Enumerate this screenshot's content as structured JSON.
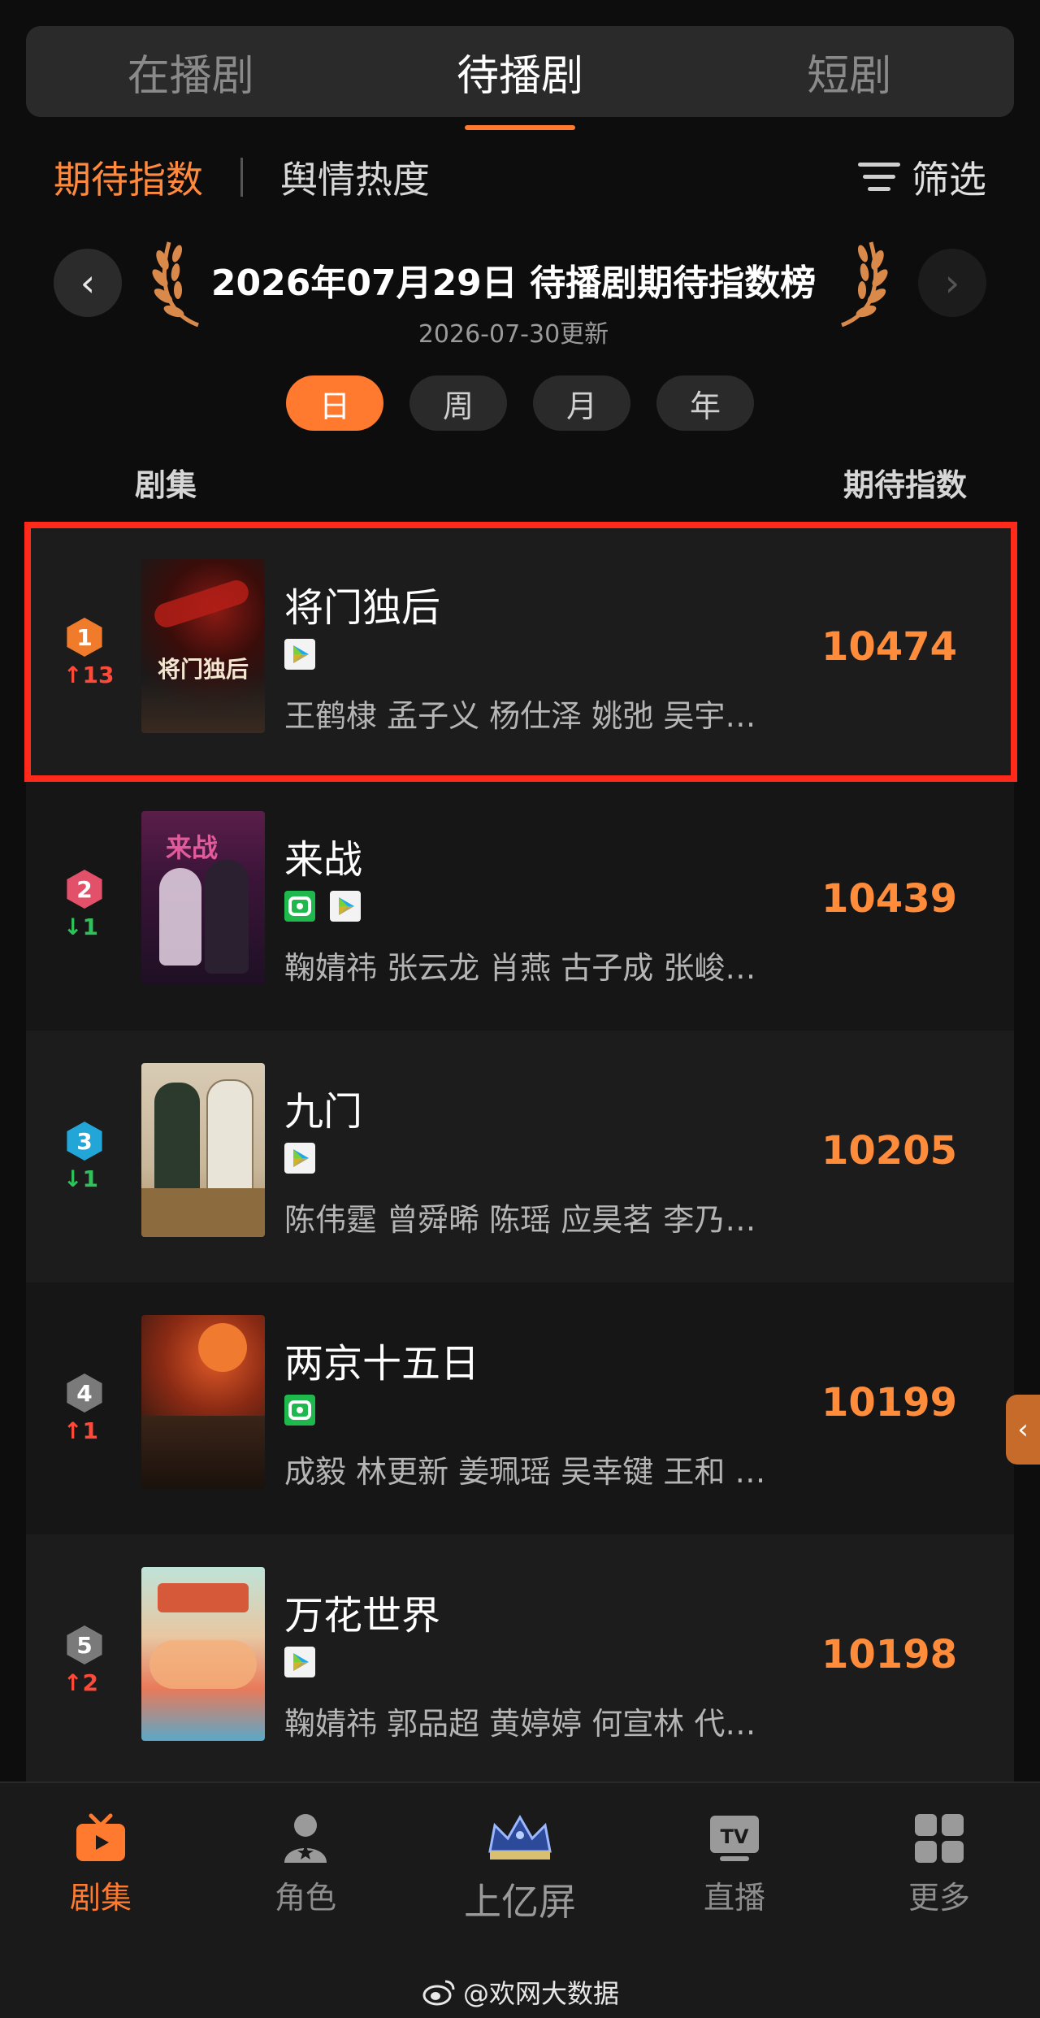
{
  "top_tabs": [
    {
      "label": "在播剧",
      "active": false
    },
    {
      "label": "待播剧",
      "active": true
    },
    {
      "label": "短剧",
      "active": false
    }
  ],
  "subtabs": [
    {
      "label": "期待指数",
      "active": true
    },
    {
      "label": "舆情热度",
      "active": false
    }
  ],
  "filter": {
    "label": "筛选",
    "icon": "filter-icon"
  },
  "board": {
    "title": "2026年07月29日 待播剧期待指数榜",
    "updated": "2026-07-30更新",
    "prev_icon": "chevron-left-icon",
    "next_icon": "chevron-right-icon"
  },
  "periods": [
    {
      "label": "日",
      "active": true
    },
    {
      "label": "周",
      "active": false
    },
    {
      "label": "月",
      "active": false
    },
    {
      "label": "年",
      "active": false
    }
  ],
  "columns": {
    "left": "剧集",
    "right": "期待指数"
  },
  "shows": [
    {
      "rank": "1",
      "rank_color": "#f07b2a",
      "change": "↑13",
      "change_color": "#ff4a3a",
      "title": "将门独后",
      "poster_text": "将门独后",
      "platforms": [
        "tencent"
      ],
      "cast": "王鹤棣 孟子义 杨仕泽 姚弛 吴宇…",
      "score": "10474",
      "highlighted": true
    },
    {
      "rank": "2",
      "rank_color": "#e2506a",
      "change": "↓1",
      "change_color": "#2fc25b",
      "title": "来战",
      "poster_text": "",
      "platforms": [
        "iqiyi",
        "tencent"
      ],
      "cast": "鞠婧祎 张云龙 肖燕 古子成 张峻…",
      "score": "10439",
      "highlighted": false
    },
    {
      "rank": "3",
      "rank_color": "#22a6d8",
      "change": "↓1",
      "change_color": "#2fc25b",
      "title": "九门",
      "poster_text": "",
      "platforms": [
        "tencent"
      ],
      "cast": "陈伟霆 曾舜晞 陈瑶 应昊茗 李乃…",
      "score": "10205",
      "highlighted": false
    },
    {
      "rank": "4",
      "rank_color": "#7a7a7a",
      "change": "↑1",
      "change_color": "#ff4a3a",
      "title": "两京十五日",
      "poster_text": "",
      "platforms": [
        "iqiyi"
      ],
      "cast": "成毅 林更新 姜珮瑶 吴幸键 王和 …",
      "score": "10199",
      "highlighted": false
    },
    {
      "rank": "5",
      "rank_color": "#7a7a7a",
      "change": "↑2",
      "change_color": "#ff4a3a",
      "title": "万花世界",
      "poster_text": "",
      "platforms": [
        "tencent"
      ],
      "cast": "鞠婧祎 郭品超 黄婷婷 何宣林 代…",
      "score": "10198",
      "highlighted": false
    }
  ],
  "bottom_nav": [
    {
      "label": "剧集",
      "icon": "tv-icon",
      "active": true
    },
    {
      "label": "角色",
      "icon": "person-star-icon",
      "active": false
    },
    {
      "label": "上亿屏",
      "icon": "crown-icon",
      "active": false
    },
    {
      "label": "直播",
      "icon": "tv-live-icon",
      "active": false
    },
    {
      "label": "更多",
      "icon": "grid-icon",
      "active": false
    }
  ],
  "credit": "@欢网大数据",
  "colors": {
    "accent": "#ff7a2e",
    "score": "#ff8c3a",
    "highlight": "#ff2a1a"
  }
}
